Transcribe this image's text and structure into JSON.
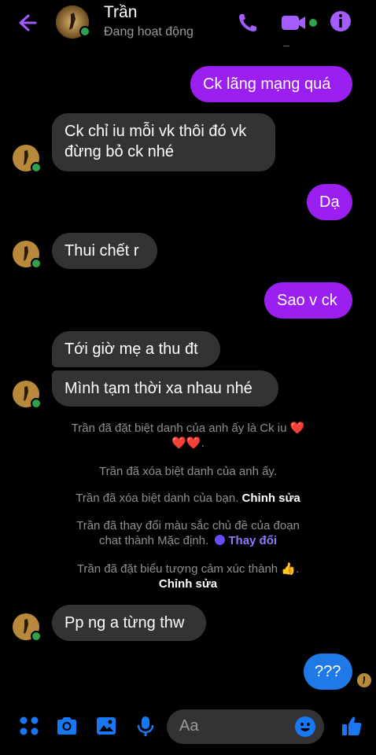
{
  "header": {
    "contact_name": "Trần",
    "status": "Đang hoạt động",
    "accent_color": "#8b5cf6"
  },
  "messages": [
    {
      "dir": "out",
      "text": "Ck lãng mạng quá"
    },
    {
      "dir": "in",
      "text_line1": "Ck chỉ iu mỗi vk thôi đó vk",
      "text_line2": "đừng bỏ ck nhé"
    },
    {
      "dir": "out",
      "text": "Dạ"
    },
    {
      "dir": "in",
      "text": "Thui chết r"
    },
    {
      "dir": "out",
      "text": "Sao v ck"
    },
    {
      "dir": "in",
      "text": "Tới giờ mẹ a thu đt"
    },
    {
      "dir": "in",
      "text": "Mình tạm thời xa nhau nhé"
    },
    {
      "dir": "in",
      "text": "Pp ng a từng thw"
    },
    {
      "dir": "out",
      "text": "???"
    }
  ],
  "system": {
    "nick_set_line1": "Trần đã đặt biệt danh của anh ấy là Ck iu",
    "nick_removed_his": "Trần đã xóa biệt danh của anh ấy.",
    "nick_removed_yours": "Trần đã xóa biệt danh của bạn.",
    "edit_label": "Chỉnh sửa",
    "theme_line1": "Trần đã thay đổi màu sắc chủ đề của đoạn",
    "theme_line2": "chat thành Mặc định.",
    "change_label": "Thay đổi",
    "emoji_line": "Trần đã đặt biểu tượng cảm xúc thành",
    "edit_label2": "Chỉnh sửa"
  },
  "composer": {
    "placeholder": "Aa"
  },
  "colors": {
    "outgoing_bubble": "#9b1ff0",
    "incoming_bubble": "#333334",
    "composer_icons": "#1877f2",
    "online_dot": "#31a24c"
  }
}
